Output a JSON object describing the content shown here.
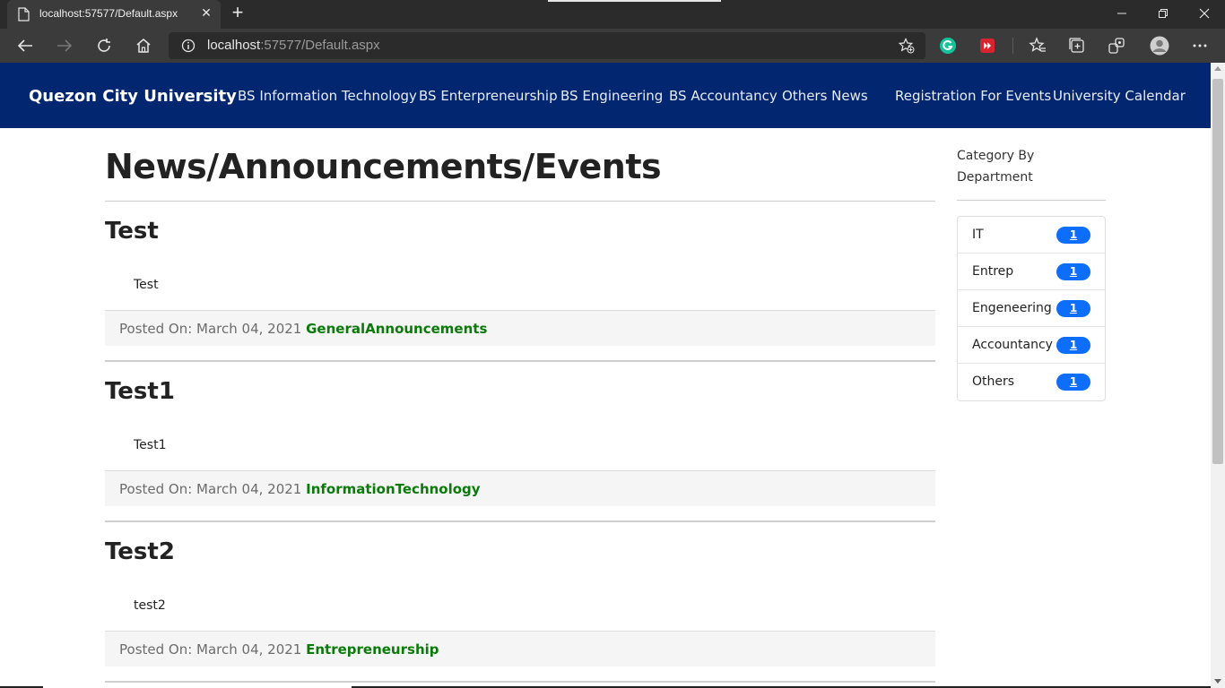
{
  "browser": {
    "tab_title": "localhost:57577/Default.aspx",
    "tab_close_glyph": "✕",
    "new_tab_glyph": "+",
    "url_host": "localhost",
    "url_path": ":57577/Default.aspx",
    "window_buttons": {
      "minimize": "—",
      "restore": "❐",
      "close": "✕"
    },
    "icons": [
      "page-icon",
      "back-icon",
      "forward-icon",
      "refresh-icon",
      "home-icon",
      "info-icon",
      "add-favorite-icon",
      "grammarly-icon",
      "extension-icon",
      "favorites-icon",
      "collections-icon",
      "sync-icon",
      "profile-icon",
      "more-icon"
    ]
  },
  "navbar": {
    "brand": "Quezon City University",
    "links": [
      "BS Information Technology",
      "BS Enterpreneurship",
      "BS Engineering",
      "BS Accountancy",
      "Others News",
      "Registration For Events",
      "University Calendar"
    ],
    "background": "#032670"
  },
  "main": {
    "title": "News/Announcements/Events",
    "posts": [
      {
        "title": "Test",
        "body": "Test",
        "posted_label": "Posted On: March 04, 2021",
        "category": "GeneralAnnouncements"
      },
      {
        "title": "Test1",
        "body": "Test1",
        "posted_label": "Posted On: March 04, 2021",
        "category": "InformationTechnology"
      },
      {
        "title": "Test2",
        "body": "test2",
        "posted_label": "Posted On: March 04, 2021",
        "category": "Entrepreneurship"
      }
    ],
    "category_color": "#0b7a0b"
  },
  "sidebar": {
    "title": "Category By Department",
    "items": [
      {
        "label": "IT",
        "count": "1"
      },
      {
        "label": "Entrep",
        "count": "1"
      },
      {
        "label": "Engeneering",
        "count": "1"
      },
      {
        "label": "Accountancy",
        "count": "1"
      },
      {
        "label": "Others",
        "count": "1"
      }
    ],
    "badge_color": "#0d6efd"
  }
}
